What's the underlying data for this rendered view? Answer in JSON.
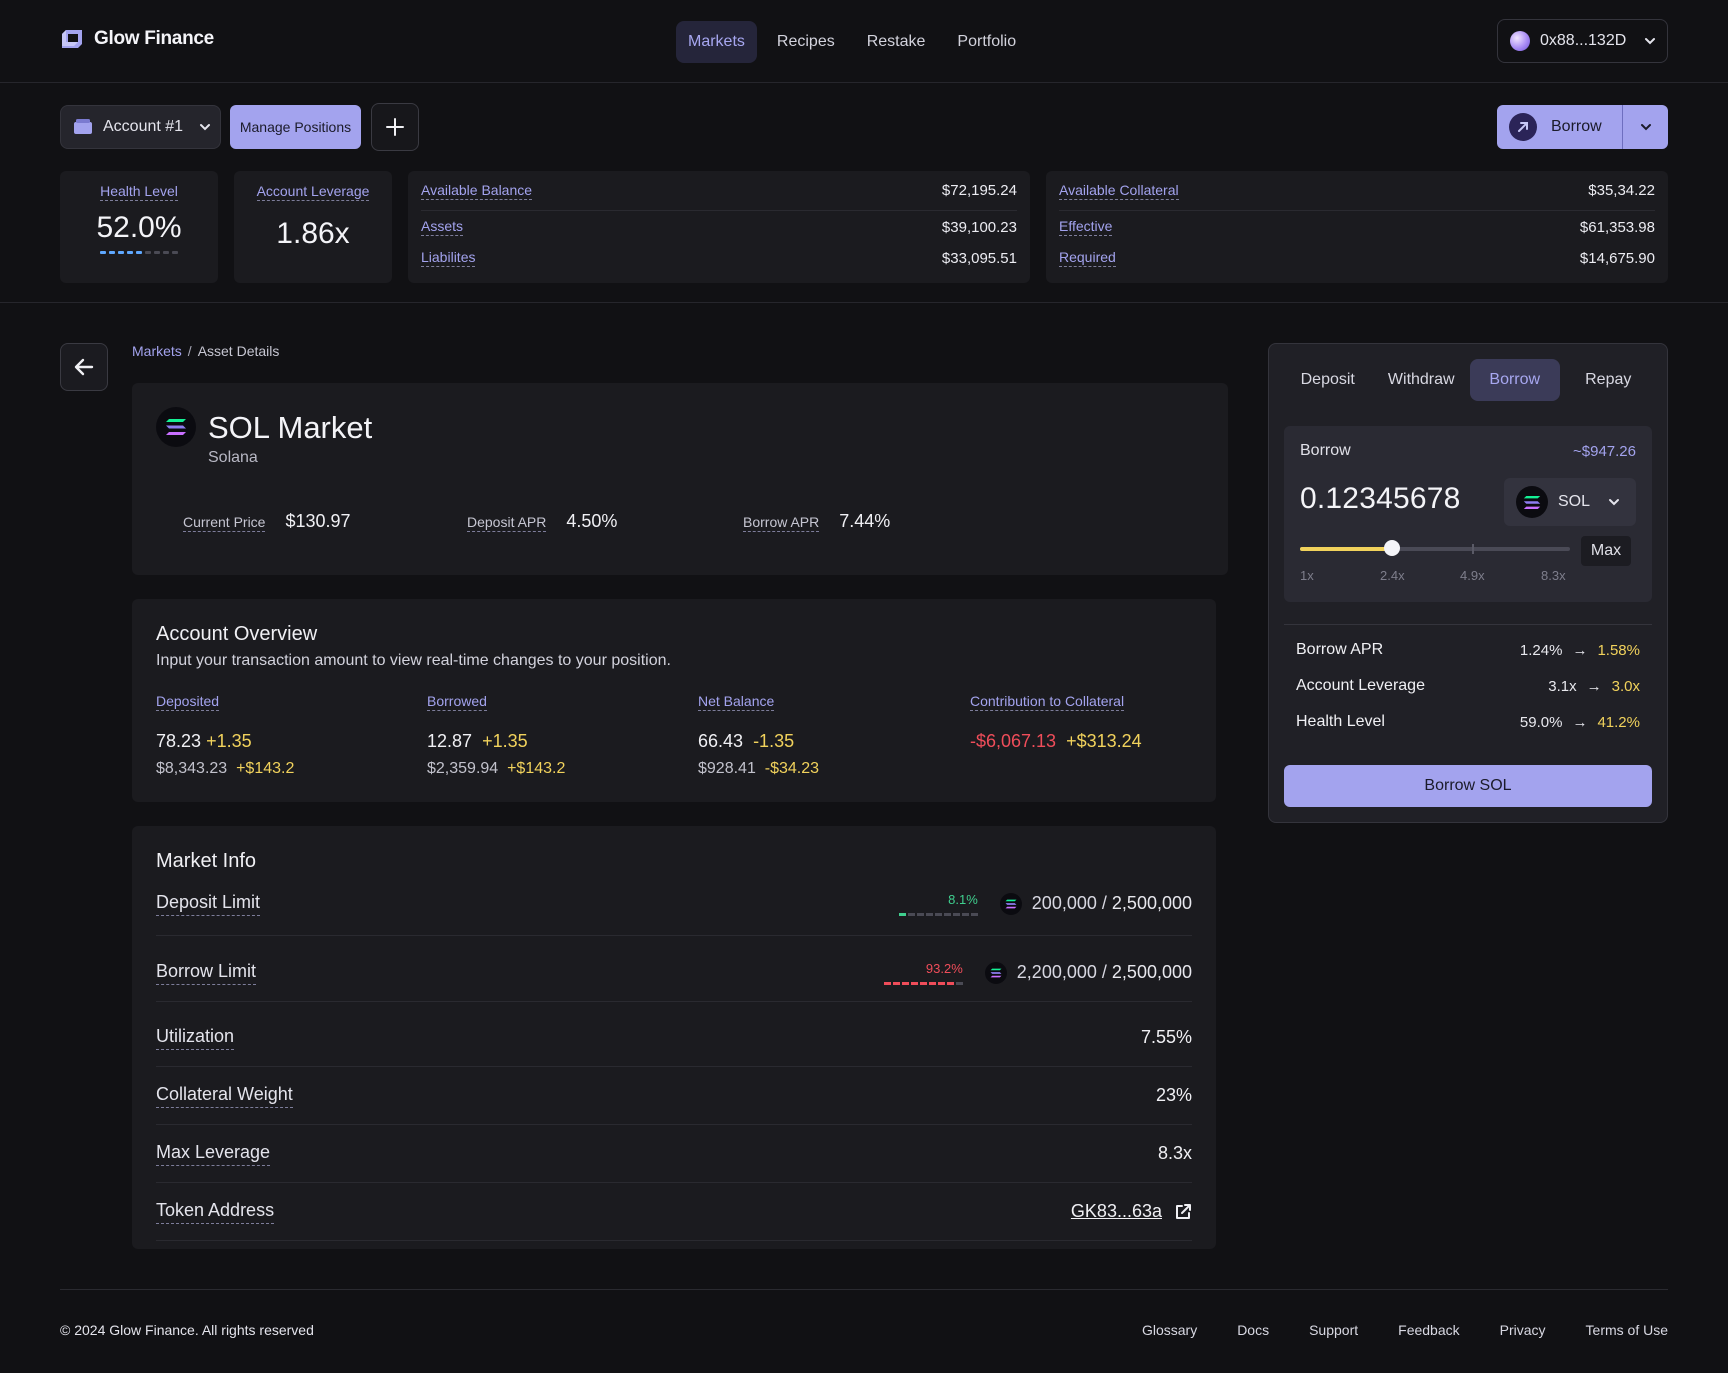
{
  "brand": {
    "name": "Glow Finance"
  },
  "nav": {
    "items": [
      {
        "label": "Markets",
        "active": true
      },
      {
        "label": "Recipes",
        "active": false
      },
      {
        "label": "Restake",
        "active": false
      },
      {
        "label": "Portfolio",
        "active": false
      }
    ]
  },
  "wallet": {
    "address": "0x88...132D"
  },
  "toolbar": {
    "account_label": "Account #1",
    "manage_label": "Manage Positions",
    "borrow_label": "Borrow"
  },
  "stats": {
    "health": {
      "label": "Health Level",
      "value": "52.0%",
      "level": 0.52
    },
    "leverage": {
      "label": "Account Leverage",
      "value": "1.86x"
    },
    "balance": {
      "available_label": "Available Balance",
      "available_value": "$72,195.24",
      "assets_label": "Assets",
      "assets_value": "$39,100.23",
      "liabilities_label": "Liabilites",
      "liabilities_value": "$33,095.51"
    },
    "collateral": {
      "available_label": "Available Collateral",
      "available_value": "$35,34.22",
      "effective_label": "Effective",
      "effective_value": "$61,353.98",
      "required_label": "Required",
      "required_value": "$14,675.90"
    }
  },
  "breadcrumb": {
    "parent": "Markets",
    "sep": "/",
    "current": "Asset Details"
  },
  "market": {
    "title": "SOL Market",
    "subtitle": "Solana",
    "price_label": "Current Price",
    "price_value": "$130.97",
    "deposit_apr_label": "Deposit APR",
    "deposit_apr_value": "4.50%",
    "borrow_apr_label": "Borrow APR",
    "borrow_apr_value": "7.44%"
  },
  "overview": {
    "title": "Account Overview",
    "subtitle": "Input your transaction amount to view real-time changes to your position.",
    "columns": [
      {
        "label": "Deposited",
        "v1": "78.23",
        "d1": "+1.35",
        "v2": "$8,343.23",
        "d2": "+$143.2"
      },
      {
        "label": "Borrowed",
        "v1": "12.87",
        "d1": "+1.35",
        "v2": "$2,359.94",
        "d2": "+$143.2"
      },
      {
        "label": "Net Balance",
        "v1": "66.43",
        "d1": "-1.35",
        "v2": "$928.41",
        "d2": "-$34.23"
      },
      {
        "label": "Contribution to Collateral",
        "v1": "-$6,067.13",
        "d1": "+$313.24"
      }
    ]
  },
  "market_info": {
    "title": "Market Info",
    "deposit_limit": {
      "label": "Deposit Limit",
      "pct": "8.1%",
      "fill": 0.081,
      "used": "200,000",
      "sep": "/",
      "total": "2,500,000"
    },
    "borrow_limit": {
      "label": "Borrow Limit",
      "pct": "93.2%",
      "fill": 0.932,
      "used": "2,200,000",
      "sep": "/",
      "total": "2,500,000"
    },
    "utilization": {
      "label": "Utilization",
      "value": "7.55%"
    },
    "collateral_weight": {
      "label": "Collateral Weight",
      "value": "23%"
    },
    "max_leverage": {
      "label": "Max Leverage",
      "value": "8.3x"
    },
    "token_address": {
      "label": "Token Address",
      "value": "GK83...63a"
    }
  },
  "panel": {
    "tabs": [
      {
        "label": "Deposit",
        "active": false
      },
      {
        "label": "Withdraw",
        "active": false
      },
      {
        "label": "Borrow",
        "active": true
      },
      {
        "label": "Repay",
        "active": false
      }
    ],
    "input_label": "Borrow",
    "usd_estimate": "~$947.26",
    "amount": "0.12345678",
    "token": "SOL",
    "max_label": "Max",
    "slider": {
      "ticks": [
        "1x",
        "2.4x",
        "4.9x",
        "8.3x"
      ],
      "value": "2.4x"
    },
    "rows": [
      {
        "label": "Borrow APR",
        "from": "1.24%",
        "arrow": "→",
        "to": "1.58%"
      },
      {
        "label": "Account Leverage",
        "from": "3.1x",
        "arrow": "→",
        "to": "3.0x"
      },
      {
        "label": "Health Level",
        "from": "59.0%",
        "arrow": "→",
        "to": "41.2%"
      }
    ],
    "submit_label": "Borrow SOL"
  },
  "footer": {
    "copyright": "© 2024 Glow Finance. All rights reserved",
    "links": [
      "Glossary",
      "Docs",
      "Support",
      "Feedback",
      "Privacy",
      "Terms of Use"
    ]
  },
  "colors": {
    "accent": "#a3a3ee",
    "positive_change": "#f1d25c",
    "negative": "#ef4d5a",
    "green": "#3fcf8e",
    "background": "#111114"
  }
}
